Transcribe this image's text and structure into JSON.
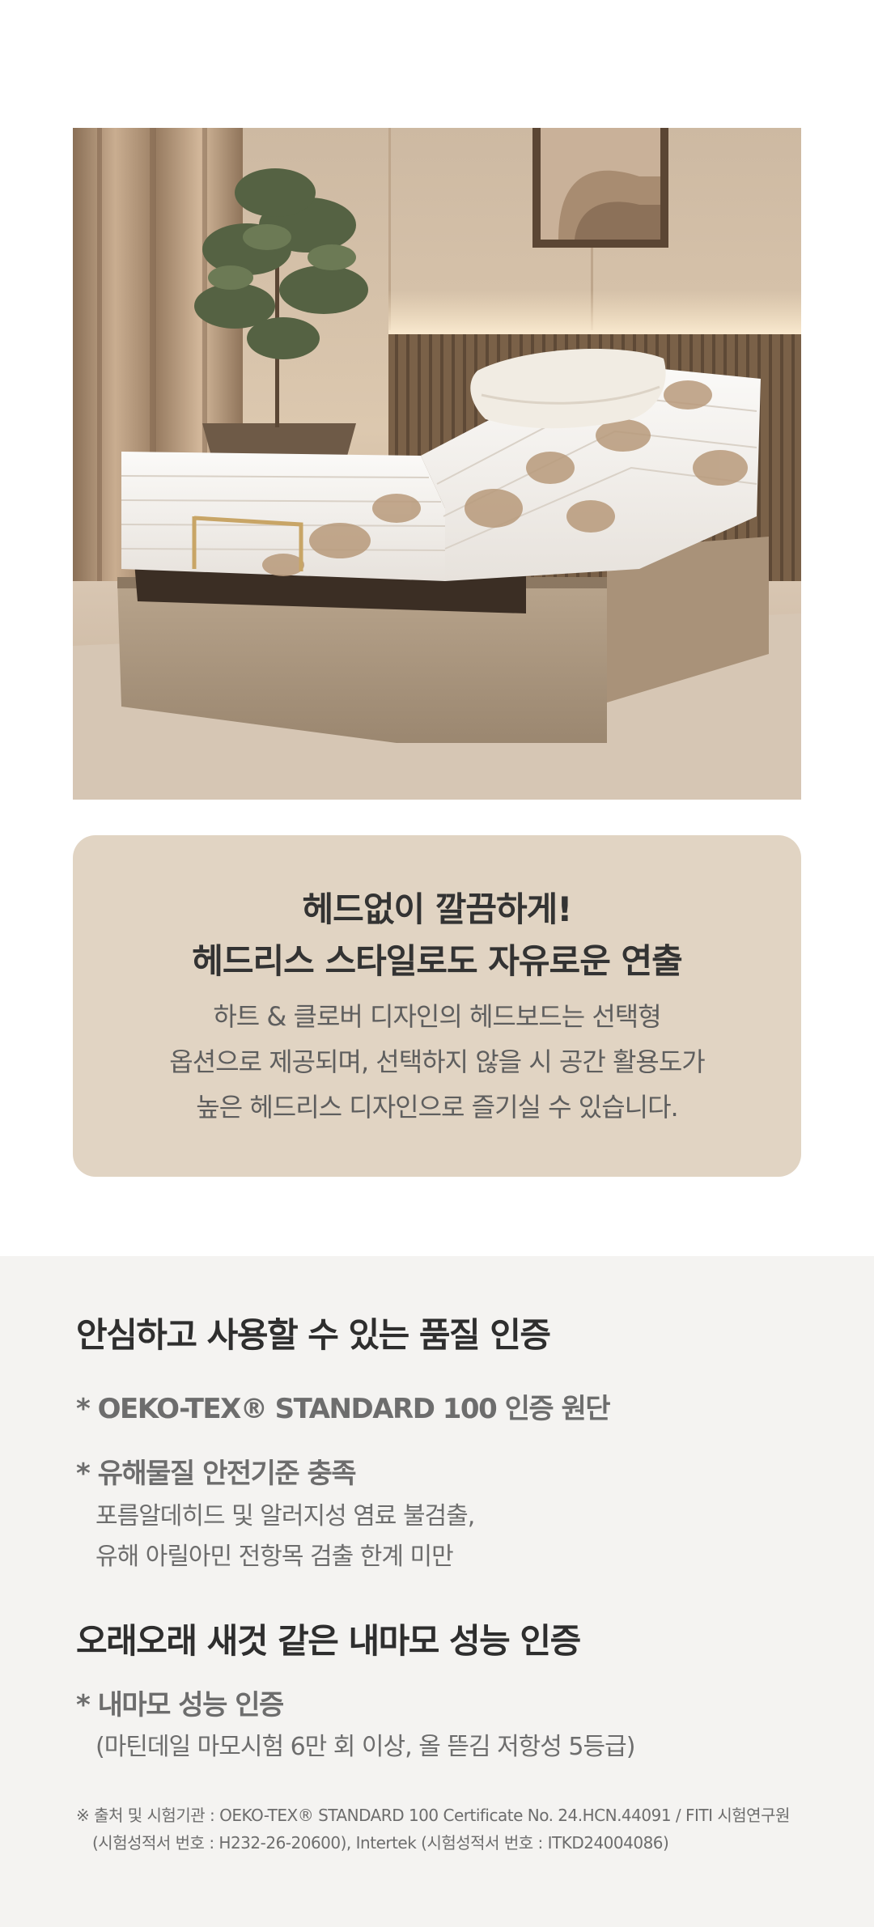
{
  "product_photo": {
    "alt": "",
    "icon": "photo-adjustable-bed"
  },
  "feature_card": {
    "headline": [
      "헤드없이 깔끔하게!",
      "헤드리스 스타일로도 자유로운 연출"
    ],
    "body": [
      "하트 & 클로버 디자인의 헤드보드는 선택형",
      "옵션으로 제공되며, 선택하지 않을 시 공간 활용도가",
      "높은 헤드리스 디자인으로 즐기실 수 있습니다."
    ],
    "background": "#e1d4c3"
  },
  "certifications": {
    "background": "#f4f3f1",
    "quality": {
      "title": "안심하고 사용할 수 있는 품질 인증",
      "item1": "* OEKO-TEX® STANDARD 100 인증 원단",
      "item2": "* 유해물질 안전기준 충족",
      "item2_details": [
        "포름알데히드 및 알러지성 염료 불검출,",
        "유해 아릴아민 전항목 검출 한계 미만"
      ]
    },
    "durability": {
      "title": "오래오래 새것 같은 내마모 성능 인증",
      "item1": "* 내마모 성능 인증",
      "item1_detail": "(마틴데일 마모시험 6만 회 이상, 올 뜯김 저항성 5등급)"
    },
    "footnote": [
      "※ 출처 및 시험기관 : OEKO-TEX® STANDARD 100 Certificate No. 24.HCN.44091 / FITI 시험연구원",
      "(시험성적서 번호 : H232-26-20600), Intertek (시험성적서 번호 : ITKD24004086)"
    ]
  }
}
